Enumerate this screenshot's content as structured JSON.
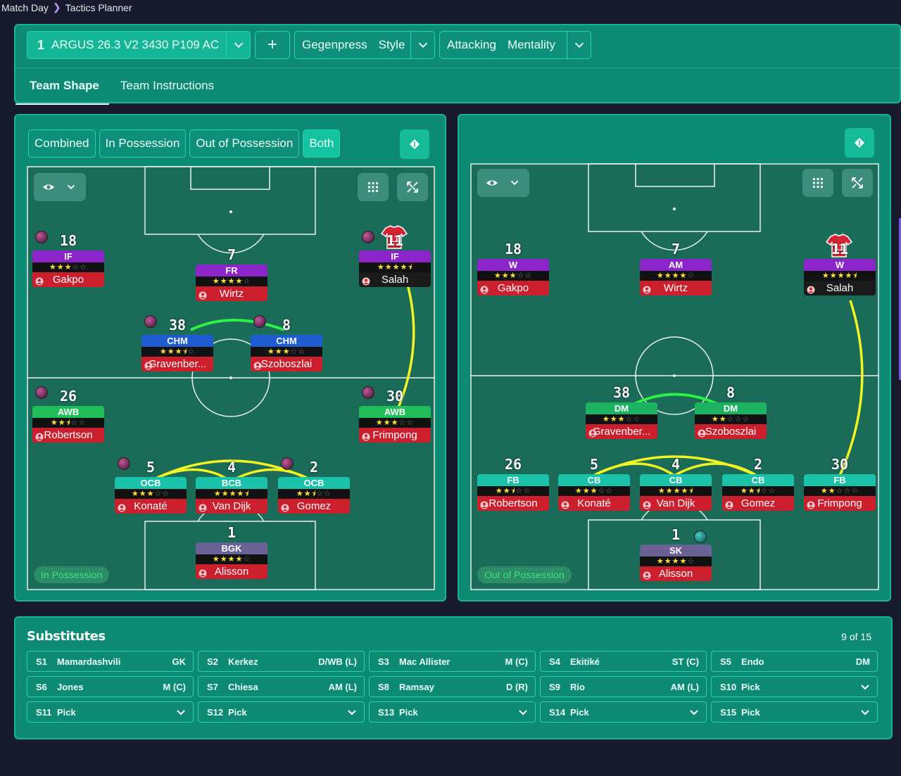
{
  "breadcrumb": {
    "root": "Match Day",
    "current": "Tactics Planner"
  },
  "tactic": {
    "slot": "1",
    "name": "ARGUS 26.3 V2 3430 P109 AC"
  },
  "style": {
    "value": "Gegenpress",
    "label": "Style"
  },
  "mentality": {
    "value": "Attacking",
    "label": "Mentality"
  },
  "tabs": {
    "shape": "Team Shape",
    "instructions": "Team Instructions"
  },
  "view_modes": [
    "Combined",
    "In Possession",
    "Out of Possession",
    "Both"
  ],
  "pitch_left": {
    "tag": "In Possession",
    "players": [
      {
        "num": "18",
        "role": "IF",
        "name": "Gakpo",
        "stars": 3,
        "cls": "role-if"
      },
      {
        "num": "7",
        "role": "FR",
        "name": "Wirtz",
        "stars": 4,
        "cls": "role-if"
      },
      {
        "num": "11",
        "role": "IF",
        "name": "Salah",
        "stars": 4.5,
        "cls": "role-if"
      },
      {
        "num": "38",
        "role": "CHM",
        "name": "Gravenber...",
        "stars": 3.5,
        "cls": "role-cm"
      },
      {
        "num": "8",
        "role": "CHM",
        "name": "Szoboszlai",
        "stars": 3,
        "cls": "role-cm"
      },
      {
        "num": "26",
        "role": "AWB",
        "name": "Robertson",
        "stars": 2.5,
        "cls": "role-wb"
      },
      {
        "num": "30",
        "role": "AWB",
        "name": "Frimpong",
        "stars": 3,
        "cls": "role-wb"
      },
      {
        "num": "5",
        "role": "OCB",
        "name": "Konaté",
        "stars": 3,
        "cls": "role-cb"
      },
      {
        "num": "4",
        "role": "BCB",
        "name": "Van Dijk",
        "stars": 4.5,
        "cls": "role-cb"
      },
      {
        "num": "2",
        "role": "OCB",
        "name": "Gomez",
        "stars": 2.5,
        "cls": "role-cb"
      },
      {
        "num": "1",
        "role": "BGK",
        "name": "Alisson",
        "stars": 4,
        "cls": "role-gk"
      }
    ]
  },
  "pitch_right": {
    "tag": "Out of Possession",
    "players": [
      {
        "num": "18",
        "role": "W",
        "name": "Gakpo",
        "stars": 3,
        "cls": "role-if"
      },
      {
        "num": "7",
        "role": "AM",
        "name": "Wirtz",
        "stars": 4,
        "cls": "role-if"
      },
      {
        "num": "11",
        "role": "W",
        "name": "Salah",
        "stars": 4.5,
        "cls": "role-if"
      },
      {
        "num": "38",
        "role": "DM",
        "name": "Gravenber...",
        "stars": 3,
        "cls": "role-dm"
      },
      {
        "num": "8",
        "role": "DM",
        "name": "Szoboszlai",
        "stars": 2,
        "cls": "role-dm"
      },
      {
        "num": "26",
        "role": "FB",
        "name": "Robertson",
        "stars": 2.5,
        "cls": "role-cb"
      },
      {
        "num": "5",
        "role": "CB",
        "name": "Konaté",
        "stars": 3,
        "cls": "role-cb"
      },
      {
        "num": "4",
        "role": "CB",
        "name": "Van Dijk",
        "stars": 4.5,
        "cls": "role-cb"
      },
      {
        "num": "2",
        "role": "CB",
        "name": "Gomez",
        "stars": 2.5,
        "cls": "role-cb"
      },
      {
        "num": "30",
        "role": "FB",
        "name": "Frimpong",
        "stars": 2,
        "cls": "role-cb"
      },
      {
        "num": "1",
        "role": "SK",
        "name": "Alisson",
        "stars": 4,
        "cls": "role-gk"
      }
    ]
  },
  "substitutes": {
    "title": "Substitutes",
    "count": "9 of 15",
    "slots": [
      {
        "slot": "S1",
        "name": "Mamardashvili",
        "pos": "GK"
      },
      {
        "slot": "S2",
        "name": "Kerkez",
        "pos": "D/WB (L)"
      },
      {
        "slot": "S3",
        "name": "Mac Allister",
        "pos": "M (C)"
      },
      {
        "slot": "S4",
        "name": "Ekitiké",
        "pos": "ST (C)"
      },
      {
        "slot": "S5",
        "name": "Endo",
        "pos": "DM"
      },
      {
        "slot": "S6",
        "name": "Jones",
        "pos": "M (C)"
      },
      {
        "slot": "S7",
        "name": "Chiesa",
        "pos": "AM (L)"
      },
      {
        "slot": "S8",
        "name": "Ramsay",
        "pos": "D (R)"
      },
      {
        "slot": "S9",
        "name": "Rio",
        "pos": "AM (L)"
      },
      {
        "slot": "S10",
        "name": "Pick",
        "pos": ""
      },
      {
        "slot": "S11",
        "name": "Pick",
        "pos": ""
      },
      {
        "slot": "S12",
        "name": "Pick",
        "pos": ""
      },
      {
        "slot": "S13",
        "name": "Pick",
        "pos": ""
      },
      {
        "slot": "S14",
        "name": "Pick",
        "pos": ""
      },
      {
        "slot": "S15",
        "name": "Pick",
        "pos": ""
      }
    ]
  },
  "colors": {
    "panel": "#0d8a74",
    "accent": "#19b394",
    "pitch": "#1a6b58",
    "background": "#171a2c"
  }
}
